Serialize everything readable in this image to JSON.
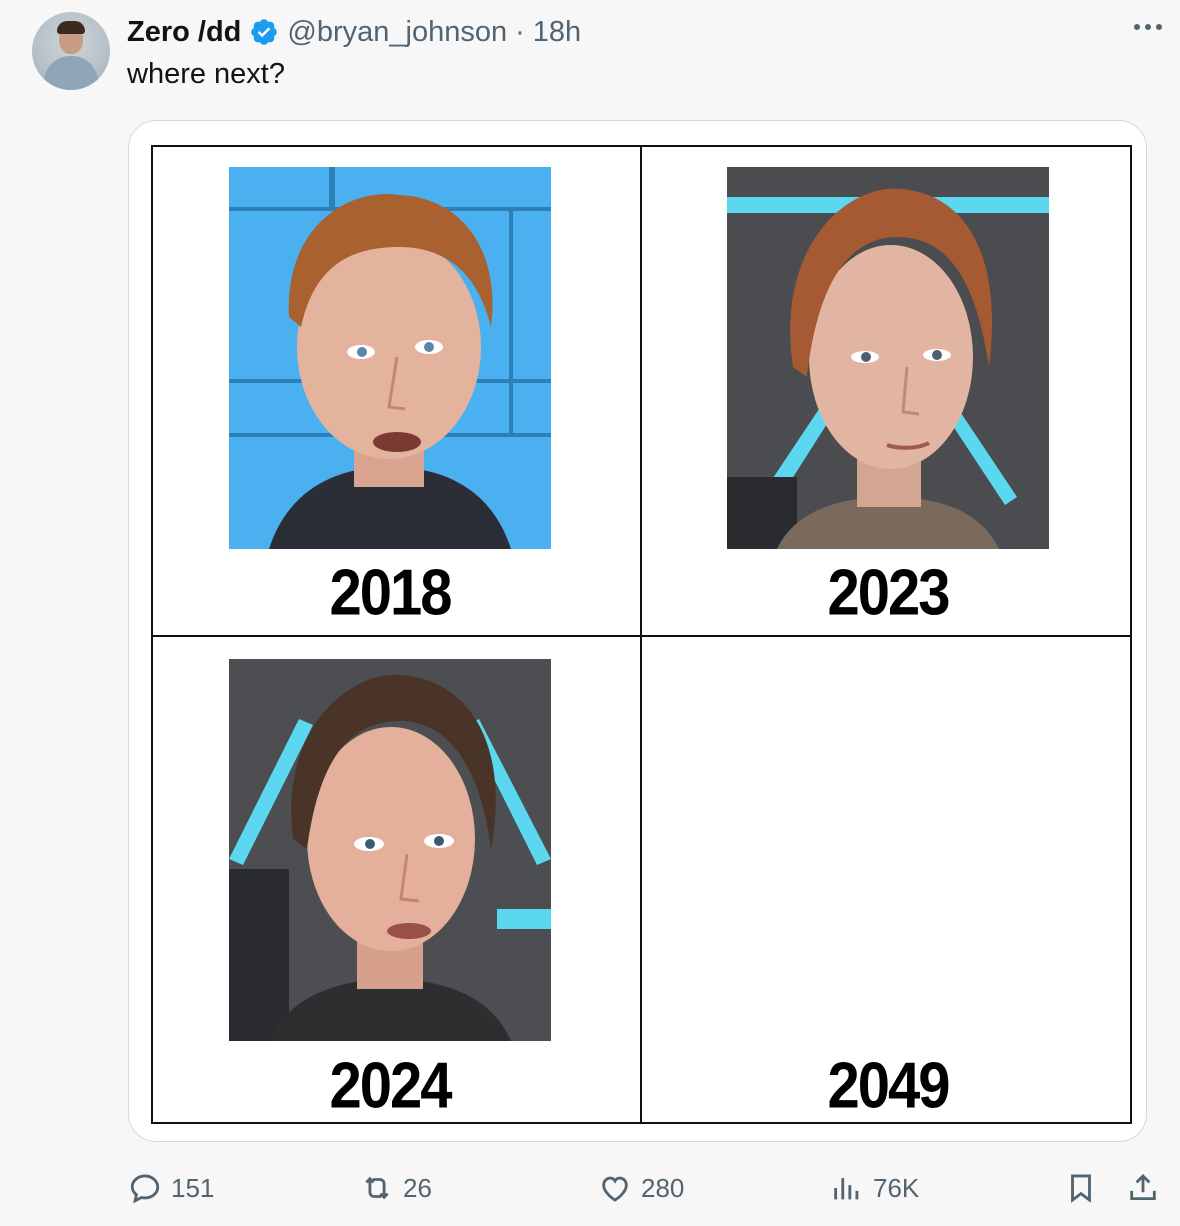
{
  "tweet": {
    "display_name": "Zero /dd",
    "handle": "@bryan_johnson",
    "separator": "·",
    "time": "18h",
    "text": "where next?"
  },
  "media": {
    "panels": [
      {
        "year": "2018",
        "image": "portrait-2018"
      },
      {
        "year": "2023",
        "image": "portrait-2023"
      },
      {
        "year": "2024",
        "image": "portrait-2024"
      },
      {
        "year": "2049",
        "image": null
      }
    ]
  },
  "actions": {
    "replies": "151",
    "reposts": "26",
    "likes": "280",
    "views": "76K"
  },
  "icons": {
    "verified": "verified-badge-icon",
    "more": "more-icon",
    "reply": "reply-icon",
    "repost": "repost-icon",
    "like": "like-icon",
    "views": "views-icon",
    "bookmark": "bookmark-icon",
    "share": "share-icon"
  },
  "colors": {
    "verified": "#1d9bf0",
    "muted": "#536471",
    "text": "#0f1419"
  }
}
